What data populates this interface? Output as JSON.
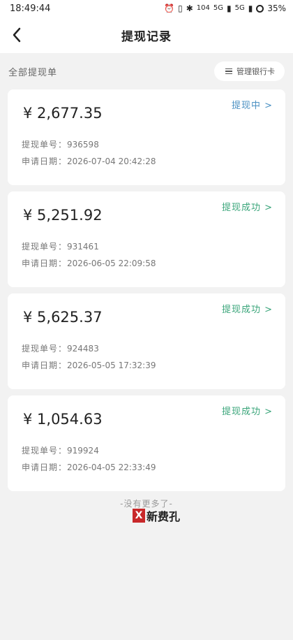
{
  "statusbar": {
    "time": "18:49:44",
    "net_speed": "104",
    "signal_a": "5G",
    "signal_b": "5G",
    "battery": "35%"
  },
  "nav": {
    "title": "提现记录"
  },
  "filter": {
    "label": "全部提现单",
    "manage_label": "管理银行卡"
  },
  "records": [
    {
      "amount": "¥ 2,677.35",
      "status": "提现中 >",
      "status_type": "pending",
      "order_label": "提现单号：",
      "order_no": "936598",
      "date_label": "申请日期：",
      "date": "2026-07-04 20:42:28"
    },
    {
      "amount": "¥ 5,251.92",
      "status": "提现成功 >",
      "status_type": "success",
      "order_label": "提现单号：",
      "order_no": "931461",
      "date_label": "申请日期：",
      "date": "2026-06-05 22:09:58"
    },
    {
      "amount": "¥ 5,625.37",
      "status": "提现成功 >",
      "status_type": "success",
      "order_label": "提现单号：",
      "order_no": "924483",
      "date_label": "申请日期：",
      "date": "2026-05-05 17:32:39"
    },
    {
      "amount": "¥ 1,054.63",
      "status": "提现成功 >",
      "status_type": "success",
      "order_label": "提现单号：",
      "order_no": "919924",
      "date_label": "申请日期：",
      "date": "2026-04-05 22:33:49"
    }
  ],
  "footer": {
    "end_text": "-没有更多了-"
  },
  "watermark": {
    "mark": "X",
    "text": "新费孔"
  },
  "colors": {
    "pending": "#4a90c2",
    "success": "#3aa57a"
  }
}
